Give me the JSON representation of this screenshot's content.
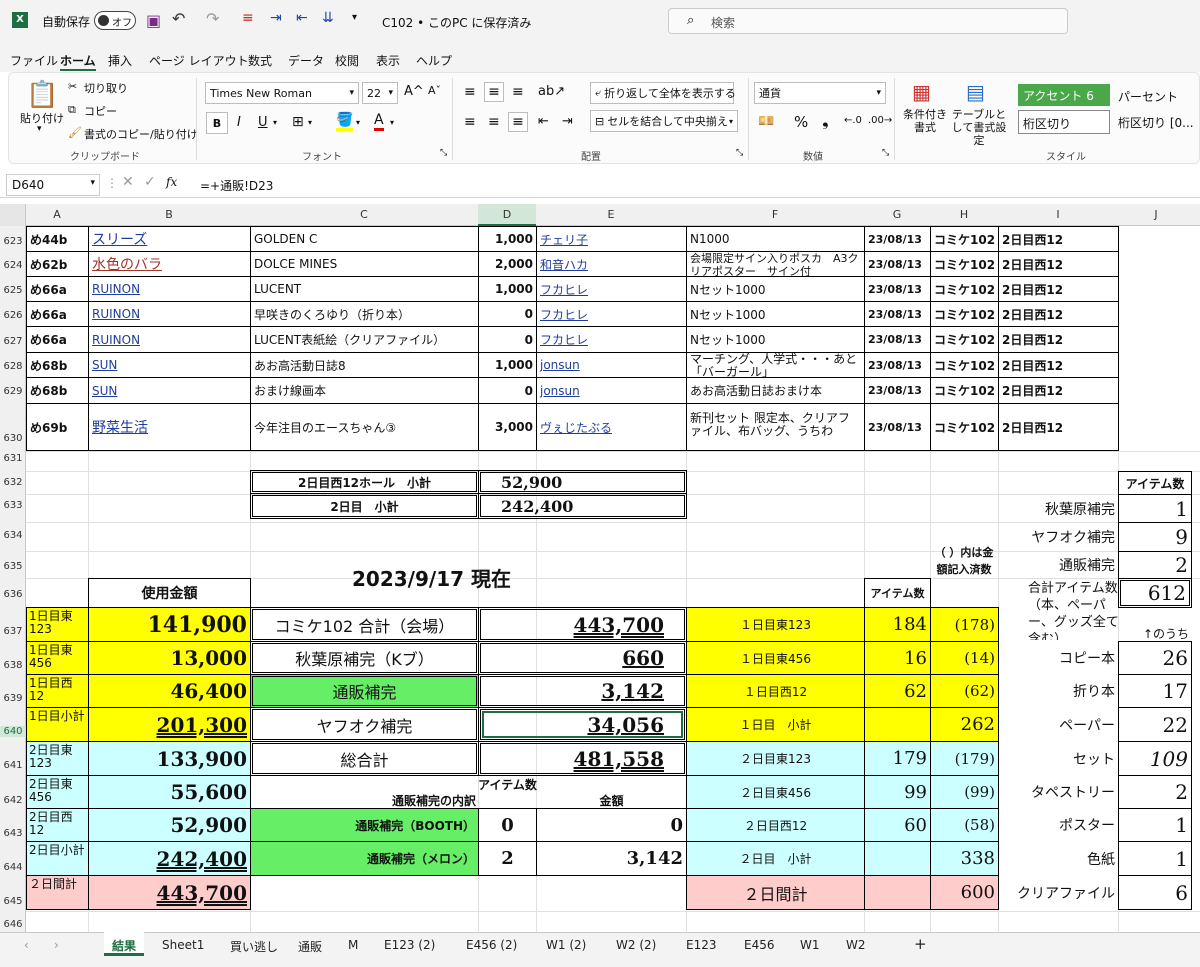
{
  "app": {
    "autosave": "自動保存",
    "autosave_state": "オフ",
    "filename": "C102 • このPC に保存済み",
    "search_placeholder": "検索"
  },
  "menu": [
    "ファイル",
    "ホーム",
    "挿入",
    "ページ レイアウト",
    "数式",
    "データ",
    "校閲",
    "表示",
    "ヘルプ"
  ],
  "ribbon": {
    "paste": "貼り付け",
    "cut": "切り取り",
    "copy": "コピー",
    "format_painter": "書式のコピー/貼り付け",
    "clipboard": "クリップボード",
    "font_name": "Times New Roman",
    "font_size": "22",
    "font_group": "フォント",
    "wrap": "折り返して全体を表示する",
    "merge": "セルを結合して中央揃え",
    "align_group": "配置",
    "number_format": "通貨",
    "number_group": "数値",
    "cond_format": "条件付き書式",
    "table_format": "テーブルとして書式設定",
    "accent6": "アクセント 6",
    "percent": "パーセント",
    "comma": "桁区切り",
    "comma0": "桁区切り [0...",
    "style_group": "スタイル"
  },
  "formula": {
    "namebox": "D640",
    "fx": "fx",
    "content": "=+通販!D23"
  },
  "columns": [
    "A",
    "B",
    "C",
    "D",
    "E",
    "F",
    "G",
    "H",
    "I",
    "J"
  ],
  "rows": [
    "623",
    "624",
    "625",
    "626",
    "627",
    "628",
    "629",
    "630",
    "631",
    "632",
    "633",
    "634",
    "635",
    "636",
    "637",
    "638",
    "639",
    "640",
    "641",
    "642",
    "643",
    "644",
    "645",
    "646"
  ],
  "list": [
    {
      "a": "め44b",
      "b": "スリーズ",
      "c": "GOLDEN C",
      "d": "1,000",
      "e": "チェリ子",
      "f": "N1000",
      "g": "23/08/13",
      "h": "コミケ102",
      "i": "2日目西12"
    },
    {
      "a": "め62b",
      "b": "水色のバラ",
      "c": "DOLCE MINES",
      "d": "2,000",
      "e": "和音ハカ",
      "f": "会場限定サイン入りポスカ　A3クリアポスター　サイン付",
      "g": "23/08/13",
      "h": "コミケ102",
      "i": "2日目西12"
    },
    {
      "a": "め66a",
      "b": "RUINON",
      "c": "LUCENT",
      "d": "1,000",
      "e": "フカヒレ",
      "f": "Nセット1000",
      "g": "23/08/13",
      "h": "コミケ102",
      "i": "2日目西12"
    },
    {
      "a": "め66a",
      "b": "RUINON",
      "c": "早咲きのくろゆり（折り本）",
      "d": "0",
      "e": "フカヒレ",
      "f": "Nセット1000",
      "g": "23/08/13",
      "h": "コミケ102",
      "i": "2日目西12"
    },
    {
      "a": "め66a",
      "b": "RUINON",
      "c": "LUCENT表紙絵（クリアファイル）",
      "d": "0",
      "e": "フカヒレ",
      "f": "Nセット1000",
      "g": "23/08/13",
      "h": "コミケ102",
      "i": "2日目西12"
    },
    {
      "a": "め68b",
      "b": "SUN",
      "c": "あお高活動日誌8",
      "d": "1,000",
      "e": "jonsun",
      "f": "マーチング、人学式・・・あと「バーガール」",
      "g": "23/08/13",
      "h": "コミケ102",
      "i": "2日目西12"
    },
    {
      "a": "め68b",
      "b": "SUN",
      "c": "おまけ線画本",
      "d": "0",
      "e": "jonsun",
      "f": "あお高活動日誌おまけ本",
      "g": "23/08/13",
      "h": "コミケ102",
      "i": "2日目西12"
    },
    {
      "a": "め69b",
      "b": "野菜生活",
      "c": "今年注目のエースちゃん③",
      "d": "3,000",
      "e": "ヴぇじたぶる",
      "f": "新刊セット 限定本、クリアファイル、布バッグ、うちわ",
      "g": "23/08/13",
      "h": "コミケ102",
      "i": "2日目西12"
    }
  ],
  "subtotals": {
    "w12_label": "2日目西12ホール　小計",
    "w12_value": "52,900",
    "d2_label": "2日目　小計",
    "d2_value": "242,400"
  },
  "date_title": "2023/9/17 現在",
  "spend": {
    "header": "使用金額",
    "rows": [
      {
        "label": "1日目東123",
        "value": "141,900"
      },
      {
        "label": "1日目東456",
        "value": "13,000"
      },
      {
        "label": "1日目西12",
        "value": "46,400"
      },
      {
        "label": "1日目小計",
        "value": "201,300"
      },
      {
        "label": "2日目東123",
        "value": "133,900"
      },
      {
        "label": "2日目東456",
        "value": "55,600"
      },
      {
        "label": "2日目西12",
        "value": "52,900"
      },
      {
        "label": "2日目小計",
        "value": "242,400"
      },
      {
        "label": "２日間計",
        "value": "443,700"
      }
    ]
  },
  "totals": [
    {
      "label": "コミケ102 合計（会場）",
      "value": "443,700"
    },
    {
      "label": "秋葉原補完（Kブ）",
      "value": "660"
    },
    {
      "label": "通販補完",
      "value": "3,142"
    },
    {
      "label": "ヤフオク補完",
      "value": "34,056"
    },
    {
      "label": "総合計",
      "value": "481,558"
    }
  ],
  "mail_order": {
    "title": "通販補完の内訳",
    "count_header": "アイテム数",
    "amount_header": "金額",
    "rows": [
      {
        "label": "通販補完（BOOTH）",
        "count": "0",
        "amount": "0"
      },
      {
        "label": "通販補完（メロン）",
        "count": "2",
        "amount": "3,142"
      }
    ]
  },
  "items": {
    "count_header": "アイテム数",
    "paren_header": "（ ）内は金額記入済数",
    "rows": [
      {
        "label": "１日目東123",
        "count": "184",
        "paren": "(178)"
      },
      {
        "label": "１日目東456",
        "count": "16",
        "paren": "(14)"
      },
      {
        "label": "１日目西12",
        "count": "62",
        "paren": "(62)"
      },
      {
        "label": "１日目　小計",
        "count": "",
        "paren": "262"
      },
      {
        "label": "２日目東123",
        "count": "179",
        "paren": "(179)"
      },
      {
        "label": "２日目東456",
        "count": "99",
        "paren": "(99)"
      },
      {
        "label": "２日目西12",
        "count": "60",
        "paren": "(58)"
      },
      {
        "label": "２日目　小計",
        "count": "",
        "paren": "338"
      },
      {
        "label": "２日間計",
        "count": "",
        "paren": "600"
      }
    ]
  },
  "right": {
    "header": "アイテム数",
    "supplements": [
      {
        "label": "秋葉原補完",
        "value": "1"
      },
      {
        "label": "ヤフオク補完",
        "value": "9"
      },
      {
        "label": "通販補完",
        "value": "2"
      }
    ],
    "total_label": "合計アイテム数（本、ペーパー、グッズ全て含む）",
    "total_value": "612",
    "breakdown_label": "↑のうち",
    "breakdown": [
      {
        "label": "コピー本",
        "value": "26"
      },
      {
        "label": "折り本",
        "value": "17"
      },
      {
        "label": "ペーパー",
        "value": "22"
      },
      {
        "label": "セット",
        "value": "109"
      },
      {
        "label": "タペストリー",
        "value": "2"
      },
      {
        "label": "ポスター",
        "value": "1"
      },
      {
        "label": "色紙",
        "value": "1"
      },
      {
        "label": "クリアファイル",
        "value": "6"
      }
    ]
  },
  "sheets": [
    "結果",
    "Sheet1",
    "買い逃し",
    "通販",
    "M",
    "E123 (2)",
    "E456 (2)",
    "W1 (2)",
    "W2 (2)",
    "E123",
    "E456",
    "W1",
    "W2"
  ]
}
